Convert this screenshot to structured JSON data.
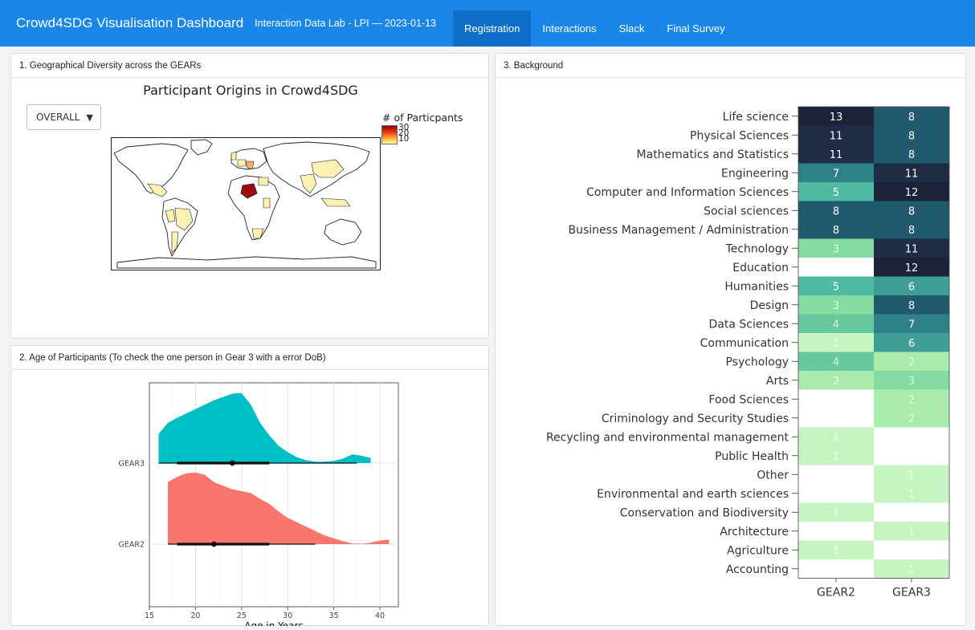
{
  "app": {
    "title": "Crowd4SDG Visualisation Dashboard",
    "subtitle": "Interaction Data Lab - LPI — 2023-01-13"
  },
  "nav": {
    "tabs": [
      {
        "label": "Registration",
        "active": true
      },
      {
        "label": "Interactions",
        "active": false
      },
      {
        "label": "Slack",
        "active": false
      },
      {
        "label": "Final Survey",
        "active": false
      }
    ],
    "color": "#1a86e8",
    "active_color": "#0f6ec7"
  },
  "panels": {
    "geo": {
      "title": "1. Geographical Diversity across the GEARs",
      "map_title": "Participant Origins in Crowd4SDG",
      "select_value": "OVERALL",
      "select_icon": "caret-down-icon",
      "legend_title": "# of Particpants",
      "legend_ticks": [
        "30",
        "20",
        "10"
      ]
    },
    "age": {
      "title": "2. Age of Participants (To check the one person in Gear 3 with a error DoB)"
    },
    "background": {
      "title": "3. Background"
    }
  },
  "chart_data": [
    {
      "type": "area",
      "x": [
        16,
        18,
        20,
        22,
        24,
        26,
        28,
        30,
        32,
        34,
        35,
        36,
        38,
        40,
        41
      ],
      "series": [
        {
          "name": "GEAR3",
          "color": "#00bfc4",
          "density": [
            [
              16,
              0.4
            ],
            [
              17,
              0.55
            ],
            [
              18,
              0.62
            ],
            [
              19,
              0.68
            ],
            [
              20,
              0.74
            ],
            [
              22,
              0.86
            ],
            [
              24,
              0.95
            ],
            [
              25,
              0.96
            ],
            [
              26,
              0.8
            ],
            [
              27,
              0.55
            ],
            [
              28,
              0.38
            ],
            [
              29,
              0.24
            ],
            [
              30,
              0.15
            ],
            [
              31,
              0.08
            ],
            [
              32,
              0.04
            ],
            [
              33,
              0.02
            ],
            [
              34,
              0.02
            ],
            [
              35,
              0.03
            ],
            [
              36,
              0.06
            ],
            [
              37,
              0.12
            ],
            [
              38,
              0.1
            ],
            [
              39,
              0.07
            ]
          ],
          "median": 24,
          "range_thin": [
            16,
            37.5
          ],
          "range_thick": [
            18,
            28
          ]
        },
        {
          "name": "GEAR2",
          "color": "#f8766d",
          "density": [
            [
              17,
              0.85
            ],
            [
              18,
              0.92
            ],
            [
              19,
              0.97
            ],
            [
              20,
              0.98
            ],
            [
              21,
              0.95
            ],
            [
              22,
              0.85
            ],
            [
              24,
              0.75
            ],
            [
              26,
              0.7
            ],
            [
              27,
              0.62
            ],
            [
              28,
              0.55
            ],
            [
              29,
              0.45
            ],
            [
              30,
              0.36
            ],
            [
              32,
              0.24
            ],
            [
              34,
              0.12
            ],
            [
              36,
              0.04
            ],
            [
              37,
              0.01
            ],
            [
              38,
              0.005
            ],
            [
              39,
              0.02
            ],
            [
              40,
              0.05
            ],
            [
              41,
              0.06
            ]
          ],
          "median": 22,
          "range_thin": [
            17,
            33
          ],
          "range_thick": [
            18,
            28
          ]
        }
      ],
      "categories": [
        "GEAR3",
        "GEAR2"
      ],
      "xlabel": "Age in Years",
      "ylabel": "",
      "xlim": [
        15,
        42
      ],
      "xticks": [
        15,
        20,
        25,
        30,
        35,
        40
      ],
      "grid": true
    },
    {
      "type": "heatmap",
      "columns": [
        "GEAR2",
        "GEAR3"
      ],
      "rows": [
        "Life science",
        "Physical Sciences",
        "Mathematics and Statistics",
        "Engineering",
        "Computer and Information Sciences",
        "Social sciences",
        "Business Management / Administration",
        "Technology",
        "Education",
        "Humanities",
        "Design",
        "Data Sciences",
        "Communication",
        "Psychology",
        "Arts",
        "Food Sciences",
        "Criminology and Security Studies",
        "Recycling and environmental management",
        "Public Health",
        "Other",
        "Environmental and earth sciences",
        "Conservation and Biodiversity",
        "Architecture",
        "Agriculture",
        "Accounting"
      ],
      "values": [
        [
          13,
          8
        ],
        [
          11,
          8
        ],
        [
          11,
          8
        ],
        [
          7,
          11
        ],
        [
          5,
          12
        ],
        [
          8,
          8
        ],
        [
          8,
          8
        ],
        [
          3,
          11
        ],
        [
          null,
          12
        ],
        [
          5,
          6
        ],
        [
          3,
          8
        ],
        [
          4,
          7
        ],
        [
          1,
          6
        ],
        [
          4,
          2
        ],
        [
          2,
          3
        ],
        [
          null,
          2
        ],
        [
          null,
          2
        ],
        [
          1,
          null
        ],
        [
          1,
          null
        ],
        [
          null,
          1
        ],
        [
          null,
          1
        ],
        [
          1,
          null
        ],
        [
          null,
          1
        ],
        [
          1,
          null
        ],
        [
          null,
          1
        ]
      ]
    }
  ]
}
